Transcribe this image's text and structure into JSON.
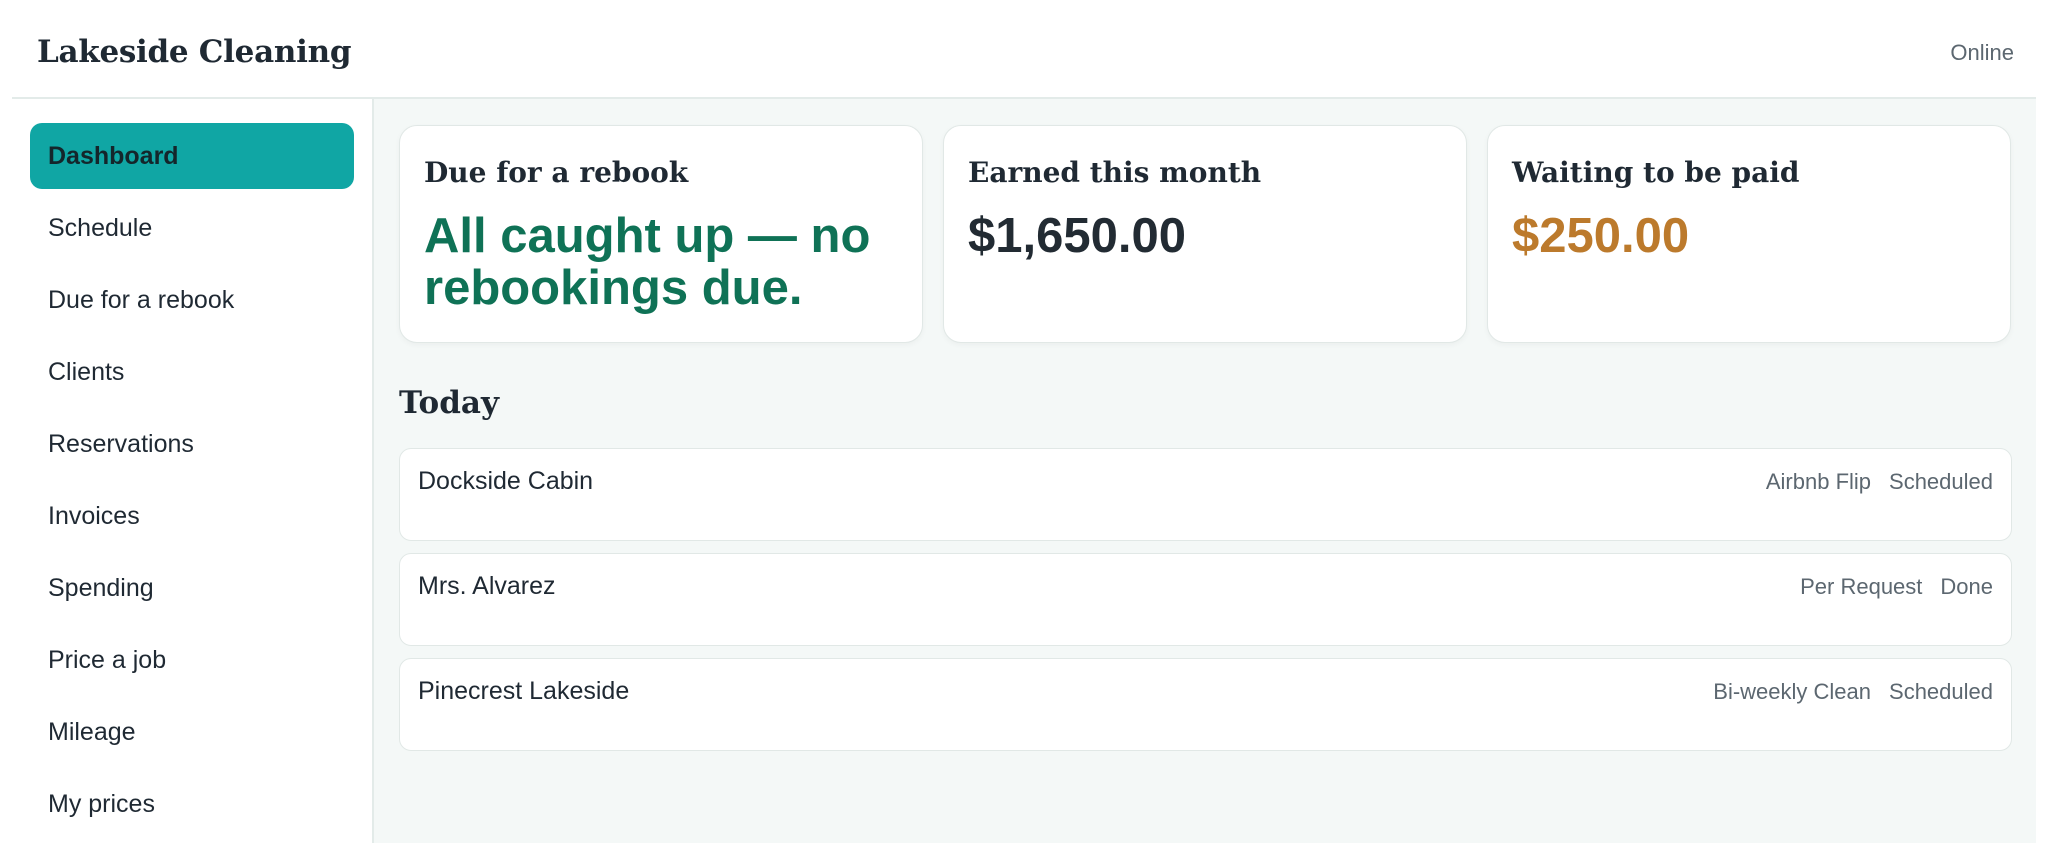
{
  "header": {
    "brand": "Lakeside Cleaning",
    "status": "Online"
  },
  "sidebar": {
    "items": [
      {
        "label": "Dashboard",
        "active": true
      },
      {
        "label": "Schedule"
      },
      {
        "label": "Due for a rebook"
      },
      {
        "label": "Clients"
      },
      {
        "label": "Reservations"
      },
      {
        "label": "Invoices"
      },
      {
        "label": "Spending"
      },
      {
        "label": "Price a job"
      },
      {
        "label": "Mileage"
      },
      {
        "label": "My prices"
      }
    ]
  },
  "cards": [
    {
      "title": "Due for a rebook",
      "value": "All caught up — no rebookings due.",
      "color": "#0f7256"
    },
    {
      "title": "Earned this month",
      "value": "$1,650.00",
      "color": "#222b33"
    },
    {
      "title": "Waiting to be paid",
      "value": "$250.00",
      "color": "#bc7a2c"
    }
  ],
  "today": {
    "title": "Today",
    "jobs": [
      {
        "name": "Dockside Cabin",
        "type": "Airbnb Flip",
        "status": "Scheduled"
      },
      {
        "name": "Mrs. Alvarez",
        "type": "Per Request",
        "status": "Done"
      },
      {
        "name": "Pinecrest Lakeside",
        "type": "Bi-weekly Clean",
        "status": "Scheduled"
      }
    ]
  },
  "colors": {
    "accent": "#10a6a4",
    "background": "#f4f8f7",
    "border": "#e1e8e6"
  }
}
